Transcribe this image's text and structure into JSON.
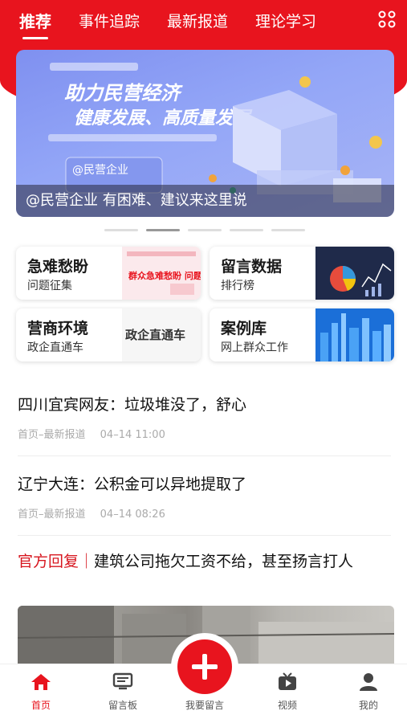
{
  "tabs": [
    {
      "label": "推荐",
      "active": true
    },
    {
      "label": "事件追踪"
    },
    {
      "label": "最新报道"
    },
    {
      "label": "理论学习"
    }
  ],
  "banner": {
    "headline_1": "助力民营经济",
    "headline_2": "健康发展、高质量发展",
    "badge": "@民营企业",
    "caption": "@民营企业 有困难、建议来这里说",
    "slides": 5,
    "current_slide": 2
  },
  "cards": [
    {
      "title": "急难愁盼",
      "subtitle": "问题征集",
      "image_text": "群众急难愁盼 问题征集"
    },
    {
      "title": "留言数据",
      "subtitle": "排行榜"
    },
    {
      "title": "营商环境",
      "subtitle": "政企直通车",
      "image_text": "政企直通车"
    },
    {
      "title": "案例库",
      "subtitle": "网上群众工作"
    }
  ],
  "news": [
    {
      "title": "四川宜宾网友：垃圾堆没了，舒心",
      "source": "首页–最新报道",
      "time": "04–14 11:00"
    },
    {
      "title": "辽宁大连：公积金可以异地提取了",
      "source": "首页–最新报道",
      "time": "04–14 08:26"
    },
    {
      "tag": "官方回复｜",
      "title": "建筑公司拖欠工资不给，甚至扬言打人"
    }
  ],
  "nav": {
    "home": "首页",
    "board": "留言板",
    "post": "我要留言",
    "video": "视频",
    "mine": "我的"
  },
  "colors": {
    "accent": "#e8141e"
  }
}
